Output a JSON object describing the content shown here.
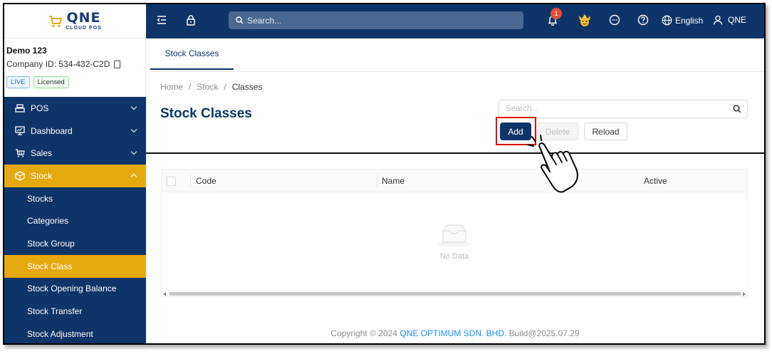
{
  "brand": {
    "logo_main": "QNE",
    "logo_sub": "CLOUD POS"
  },
  "company": {
    "name": "Demo 123",
    "id_text": "Company ID: 534-432-C2D",
    "badge_live": "LIVE",
    "badge_licensed": "Licensed"
  },
  "sidebar": {
    "items": [
      {
        "label": "POS",
        "icon": "pos-register-icon"
      },
      {
        "label": "Dashboard",
        "icon": "dashboard-monitor-icon"
      },
      {
        "label": "Sales",
        "icon": "sales-cart-icon"
      },
      {
        "label": "Stock",
        "icon": "stock-box-icon"
      }
    ],
    "sub_items": [
      {
        "label": "Stocks"
      },
      {
        "label": "Categories"
      },
      {
        "label": "Stock Group"
      },
      {
        "label": "Stock Class"
      },
      {
        "label": "Stock Opening Balance"
      },
      {
        "label": "Stock Transfer"
      },
      {
        "label": "Stock Adjustment"
      }
    ]
  },
  "topbar": {
    "search_placeholder": "Search...",
    "notification_count": "1",
    "language": "English",
    "user": "QNE"
  },
  "tabs": [
    {
      "label": "Stock Classes"
    }
  ],
  "breadcrumb": {
    "home": "Home",
    "stock": "Stock",
    "current": "Classes"
  },
  "page": {
    "title": "Stock Classes",
    "search_placeholder": "Search..."
  },
  "toolbar": {
    "add_label": "Add",
    "delete_label": "Delete",
    "reload_label": "Reload"
  },
  "table": {
    "columns": [
      "Code",
      "Name",
      "Active"
    ],
    "empty_text": "No Data"
  },
  "footer": {
    "prefix": "Copyright ",
    "year": "2024",
    "company": "QNE OPTIMUM SDN. BHD.",
    "build": "Build@2025.07.29"
  },
  "colors": {
    "navy": "#0e3569",
    "accent": "#e5a910",
    "highlight": "#e00000"
  }
}
